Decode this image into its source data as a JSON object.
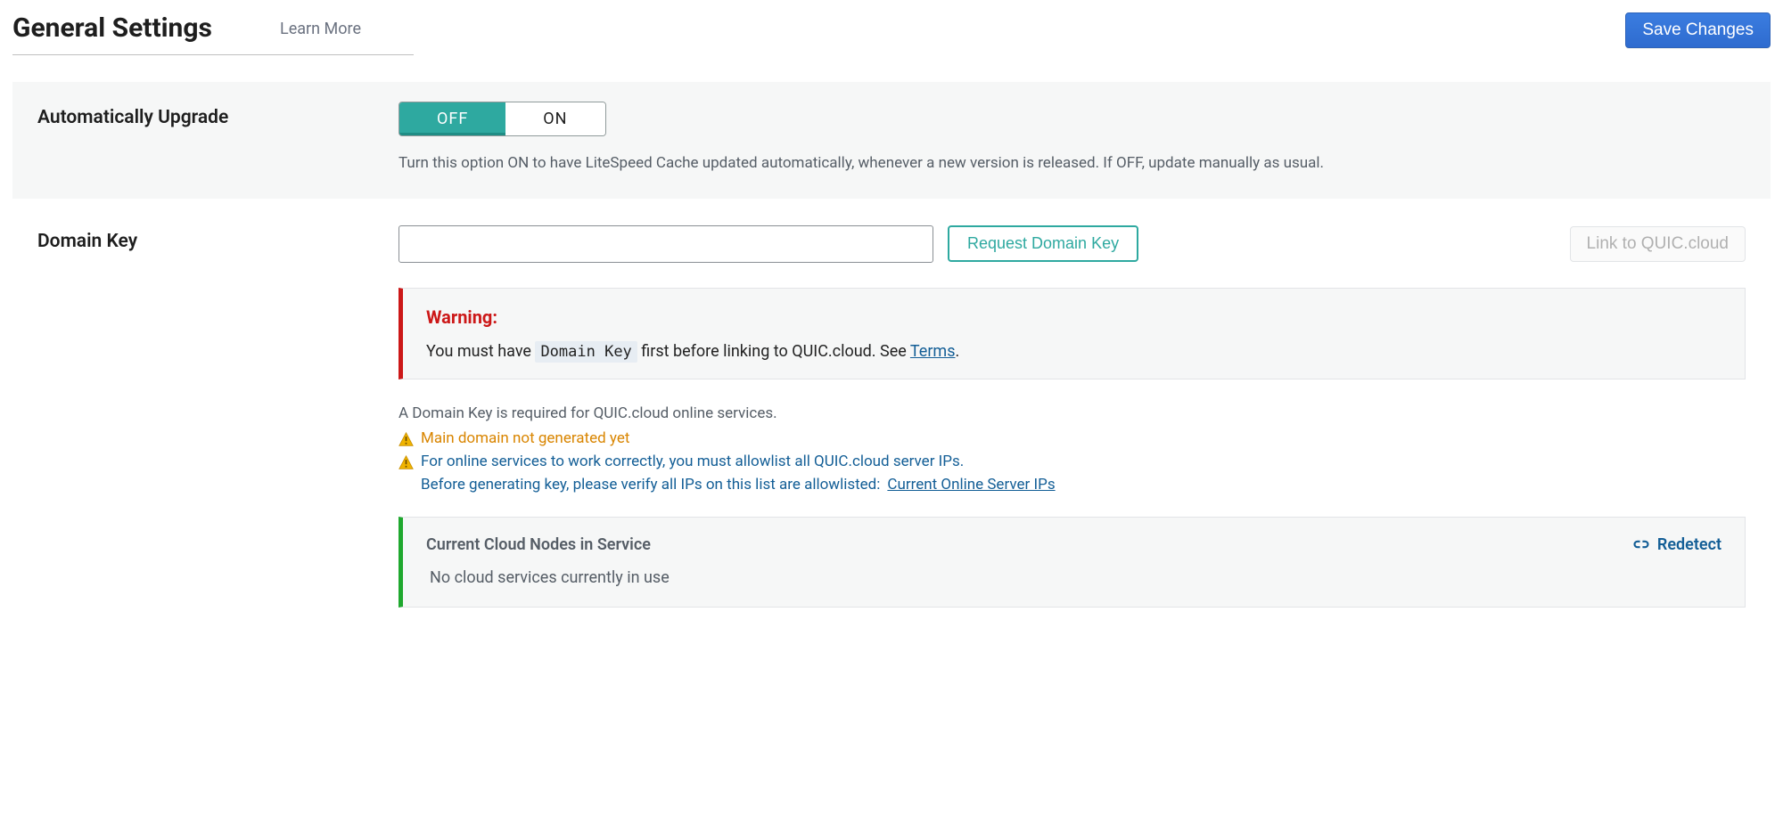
{
  "header": {
    "title": "General Settings",
    "learn_more": "Learn More",
    "save": "Save Changes"
  },
  "auto_upgrade": {
    "label": "Automatically Upgrade",
    "off": "OFF",
    "on": "ON",
    "active": "off",
    "desc": "Turn this option ON to have LiteSpeed Cache updated automatically, whenever a new version is released. If OFF, update manually as usual."
  },
  "domain_key": {
    "label": "Domain Key",
    "value": "",
    "request_btn": "Request Domain Key",
    "link_quic_btn": "Link to QUIC.cloud",
    "warning_title": "Warning:",
    "warning_pre": "You must have ",
    "warning_code": "Domain Key",
    "warning_post": " first before linking to QUIC.cloud. See ",
    "terms_link": "Terms",
    "warning_period": ".",
    "hint": "A Domain Key is required for QUIC.cloud online services.",
    "warn1": "Main domain not generated yet",
    "warn2": "For online services to work correctly, you must allowlist all QUIC.cloud server IPs.",
    "warn3_pre": "Before generating key, please verify all IPs on this list are allowlisted: ",
    "warn3_link": "Current Online Server IPs"
  },
  "nodes": {
    "title": "Current Cloud Nodes in Service",
    "redetect": "Redetect",
    "empty": "No cloud services currently in use"
  }
}
